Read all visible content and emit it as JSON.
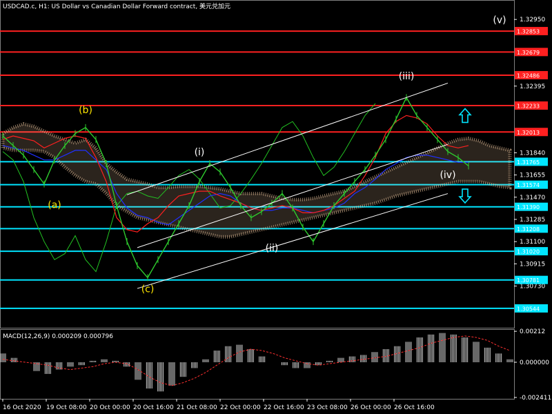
{
  "window": {
    "title": "USDCAD.c, H1:  US Dollar vs Canadian Dollar Forward contract, 美元兑加元"
  },
  "colors": {
    "background": "#000000",
    "price_line": "#2ecc2e",
    "resistance": "#ff2020",
    "support": "#00e5ff",
    "tenkan": "#ff2020",
    "kijun": "#2030ff",
    "chikou": "#22c322",
    "kumo": "#f0c8a0",
    "channel": "#ffffff",
    "macd_hist": "#d0d0d0",
    "macd_signal": "#ff3030",
    "wave_label_yellow": "#ffe600",
    "wave_label_white": "#ffffff",
    "arrow": "#00e5ff"
  },
  "chart_data": [
    {
      "type": "line",
      "symbol": "USDCAD.c",
      "timeframe": "H1",
      "title": "USDCAD.c, H1:  US Dollar vs Canadian Dollar Forward contract, 美元兑加元",
      "ylim": [
        1.304,
        1.3302
      ],
      "yticks": [
        "1.32950",
        "1.32395",
        "1.31840",
        "1.31655",
        "1.31470",
        "1.31285",
        "1.31100",
        "1.30915",
        "1.30730"
      ],
      "xticks": [
        "16 Oct 2020",
        "19 Oct 08:00",
        "20 Oct 00:00",
        "20 Oct 16:00",
        "21 Oct 08:00",
        "22 Oct 00:00",
        "22 Oct 16:00",
        "23 Oct 08:00",
        "26 Oct 00:00",
        "26 Oct 16:00"
      ],
      "price": [
        1.3198,
        1.319,
        1.3182,
        1.317,
        1.3158,
        1.3178,
        1.319,
        1.32,
        1.3205,
        1.3195,
        1.3175,
        1.314,
        1.311,
        1.309,
        1.308,
        1.3095,
        1.311,
        1.3125,
        1.314,
        1.316,
        1.3175,
        1.3168,
        1.3155,
        1.314,
        1.313,
        1.3135,
        1.3142,
        1.315,
        1.3138,
        1.3122,
        1.311,
        1.3125,
        1.314,
        1.315,
        1.316,
        1.317,
        1.3182,
        1.3195,
        1.3212,
        1.323,
        1.3215,
        1.3205,
        1.3195,
        1.3185,
        1.318,
        1.3173
      ],
      "tenkan": [
        1.3195,
        1.3198,
        1.3196,
        1.3194,
        1.3188,
        1.3192,
        1.3196,
        1.3198,
        1.3196,
        1.318,
        1.316,
        1.313,
        1.312,
        1.3118,
        1.3125,
        1.313,
        1.314,
        1.3148,
        1.315,
        1.3152,
        1.3152,
        1.3148,
        1.3145,
        1.3142,
        1.3138,
        1.3136,
        1.3138,
        1.314,
        1.3138,
        1.3134,
        1.3134,
        1.3136,
        1.314,
        1.3146,
        1.3152,
        1.3165,
        1.318,
        1.32,
        1.321,
        1.3215,
        1.3213,
        1.3208,
        1.3198,
        1.319,
        1.3188,
        1.319
      ],
      "kijun": [
        1.319,
        1.3188,
        1.3186,
        1.3182,
        1.3178,
        1.3178,
        1.3182,
        1.3186,
        1.3186,
        1.3178,
        1.317,
        1.315,
        1.3138,
        1.3132,
        1.313,
        1.3126,
        1.3124,
        1.313,
        1.3136,
        1.3142,
        1.3148,
        1.315,
        1.3148,
        1.3142,
        1.3138,
        1.3136,
        1.3136,
        1.3138,
        1.3138,
        1.3136,
        1.3134,
        1.3136,
        1.3138,
        1.3142,
        1.315,
        1.3155,
        1.3162,
        1.317,
        1.3175,
        1.318,
        1.3182,
        1.3182,
        1.318,
        1.3178,
        1.3176,
        1.3176
      ],
      "chikou": [
        1.3185,
        1.3178,
        1.316,
        1.313,
        1.311,
        1.3095,
        1.31,
        1.3115,
        1.3095,
        1.3085,
        1.311,
        1.314,
        1.315,
        1.3152,
        1.3148,
        1.3146,
        1.3155,
        1.3165,
        1.317,
        1.3162,
        1.315,
        1.3138,
        1.314,
        1.315,
        1.3162,
        1.3175,
        1.319,
        1.3205,
        1.321,
        1.3198,
        1.318,
        1.3165,
        1.3172,
        1.3185,
        1.32,
        1.3215,
        1.3225
      ],
      "kumo_top": [
        1.32,
        1.3205,
        1.3208,
        1.3206,
        1.3202,
        1.3198,
        1.3195,
        1.3192,
        1.3195,
        1.3188,
        1.3175,
        1.3168,
        1.3162,
        1.316,
        1.3158,
        1.3155,
        1.3155,
        1.3156,
        1.3156,
        1.3156,
        1.3155,
        1.3154,
        1.3152,
        1.315,
        1.315,
        1.315,
        1.3148,
        1.3146,
        1.3145,
        1.3145,
        1.3146,
        1.3148,
        1.315,
        1.3152,
        1.3156,
        1.316,
        1.3164,
        1.3168,
        1.3172,
        1.3176,
        1.318,
        1.3184,
        1.3188,
        1.3192,
        1.3195,
        1.3196,
        1.3194,
        1.319,
        1.3188,
        1.3186
      ],
      "kumo_bottom": [
        1.3188,
        1.3186,
        1.3186,
        1.3186,
        1.3185,
        1.318,
        1.3172,
        1.3165,
        1.316,
        1.3158,
        1.315,
        1.314,
        1.3135,
        1.313,
        1.3128,
        1.3126,
        1.3124,
        1.3122,
        1.312,
        1.3118,
        1.3116,
        1.3114,
        1.3114,
        1.3116,
        1.3118,
        1.312,
        1.3122,
        1.3124,
        1.3126,
        1.3128,
        1.313,
        1.3132,
        1.3134,
        1.3136,
        1.3138,
        1.314,
        1.3142,
        1.3145,
        1.3148,
        1.315,
        1.3152,
        1.3154,
        1.3156,
        1.3158,
        1.316,
        1.316,
        1.316,
        1.3158,
        1.3156,
        1.3155
      ],
      "resistance_levels": [
        {
          "label": "1.32853",
          "value": 1.32853
        },
        {
          "label": "1.32679",
          "value": 1.32679
        },
        {
          "label": "1.32486",
          "value": 1.32486
        },
        {
          "label": "1.32233",
          "value": 1.32233
        },
        {
          "label": "1.32013",
          "value": 1.32013
        }
      ],
      "support_levels": [
        {
          "label": "1.31765",
          "value": 1.31765
        },
        {
          "label": "1.31574",
          "value": 1.31574
        },
        {
          "label": "1.31390",
          "value": 1.3139
        },
        {
          "label": "1.31208",
          "value": 1.31208
        },
        {
          "label": "1.31020",
          "value": 1.3102
        },
        {
          "label": "1.30781",
          "value": 1.30781
        },
        {
          "label": "1.30544",
          "value": 1.30544
        }
      ],
      "wave_labels": [
        {
          "text": "(a)",
          "index": 5,
          "price": 1.3138,
          "color": "yellow"
        },
        {
          "text": "(b)",
          "index": 8,
          "price": 1.3217,
          "color": "yellow"
        },
        {
          "text": "(c)",
          "index": 14,
          "price": 1.3068,
          "color": "yellow"
        },
        {
          "text": "(i)",
          "index": 19,
          "price": 1.3182,
          "color": "white"
        },
        {
          "text": "(ii)",
          "index": 26,
          "price": 1.3102,
          "color": "white"
        },
        {
          "text": "(iii)",
          "index": 39,
          "price": 1.3245,
          "color": "white"
        },
        {
          "text": "(iv)",
          "index": 43,
          "price": 1.3163,
          "color": "white"
        },
        {
          "text": "(v)",
          "index": 48,
          "price": 1.3292,
          "color": "white"
        }
      ],
      "channel": {
        "upper": [
          [
            12,
            1.3149
          ],
          [
            43,
            1.3242
          ]
        ],
        "middle": [
          [
            13,
            1.3105
          ],
          [
            43,
            1.3191
          ]
        ],
        "lower": [
          [
            13,
            1.3071
          ],
          [
            43,
            1.315
          ]
        ]
      },
      "arrows": [
        {
          "direction": "up",
          "index": 44,
          "price": 1.3215
        },
        {
          "direction": "down",
          "index": 44,
          "price": 1.3148
        }
      ]
    },
    {
      "type": "bar",
      "title": "MACD(12,26,9) 0.000209 0.000796",
      "ylim": [
        -0.002411,
        0.002127
      ],
      "yticks": [
        "0.00212",
        "0.000000",
        "-0.002411"
      ],
      "histogram": [
        0.0006,
        0.0003,
        0.0,
        -0.0006,
        -0.0008,
        -0.0005,
        -0.0003,
        -0.0002,
        0.0001,
        0.0002,
        0.0001,
        -0.0003,
        -0.0012,
        -0.0018,
        -0.002,
        -0.0016,
        -0.001,
        -0.0004,
        0.0002,
        0.0008,
        0.0011,
        0.0012,
        0.0009,
        0.0004,
        0.0,
        -0.0002,
        -0.0004,
        -0.0004,
        -0.0002,
        0.0001,
        0.0003,
        0.0004,
        0.0005,
        0.0007,
        0.0009,
        0.0011,
        0.0014,
        0.0017,
        0.0019,
        0.002,
        0.0019,
        0.0017,
        0.0014,
        0.001,
        0.0006,
        0.0002
      ],
      "signal": [
        0.0002,
        0.0001,
        0.0,
        -0.0001,
        -0.0002,
        -0.0004,
        -0.0005,
        -0.0004,
        -0.0003,
        -0.0001,
        0.0,
        -0.0001,
        -0.0005,
        -0.001,
        -0.0014,
        -0.0016,
        -0.0014,
        -0.0011,
        -0.0007,
        -0.0002,
        0.0003,
        0.0007,
        0.0009,
        0.0008,
        0.0006,
        0.0003,
        0.0001,
        -0.0001,
        -0.0002,
        -0.0001,
        0.0,
        0.0001,
        0.0002,
        0.0003,
        0.0004,
        0.0006,
        0.0008,
        0.001,
        0.0013,
        0.0015,
        0.0017,
        0.0018,
        0.0017,
        0.0015,
        0.0011,
        0.0008
      ]
    }
  ],
  "macd": {
    "label": "MACD(12,26,9) 0.000209 0.000796"
  }
}
